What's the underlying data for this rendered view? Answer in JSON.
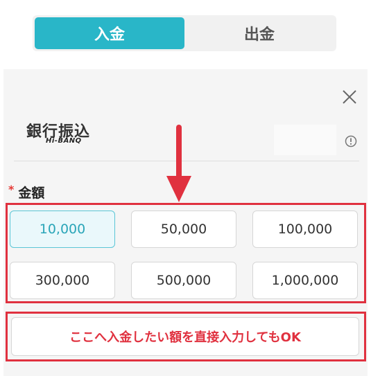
{
  "tabs": [
    {
      "label": "入金",
      "active": true
    },
    {
      "label": "出金",
      "active": false
    }
  ],
  "bank": {
    "name": "銀行振込",
    "logo_text": "Hi-BANQ"
  },
  "amount": {
    "label": "金額",
    "required_mark": "*",
    "options": [
      "10,000",
      "50,000",
      "100,000",
      "300,000",
      "500,000",
      "1,000,000"
    ],
    "selected": "10,000"
  },
  "direct_input_note": "ここへ入金したい額を直接入力してもOK",
  "colors": {
    "accent": "#29b6c8",
    "highlight_red": "#e0313f"
  },
  "icons": {
    "close": "close-icon",
    "info": "info-icon",
    "arrow": "arrow-down-icon"
  }
}
